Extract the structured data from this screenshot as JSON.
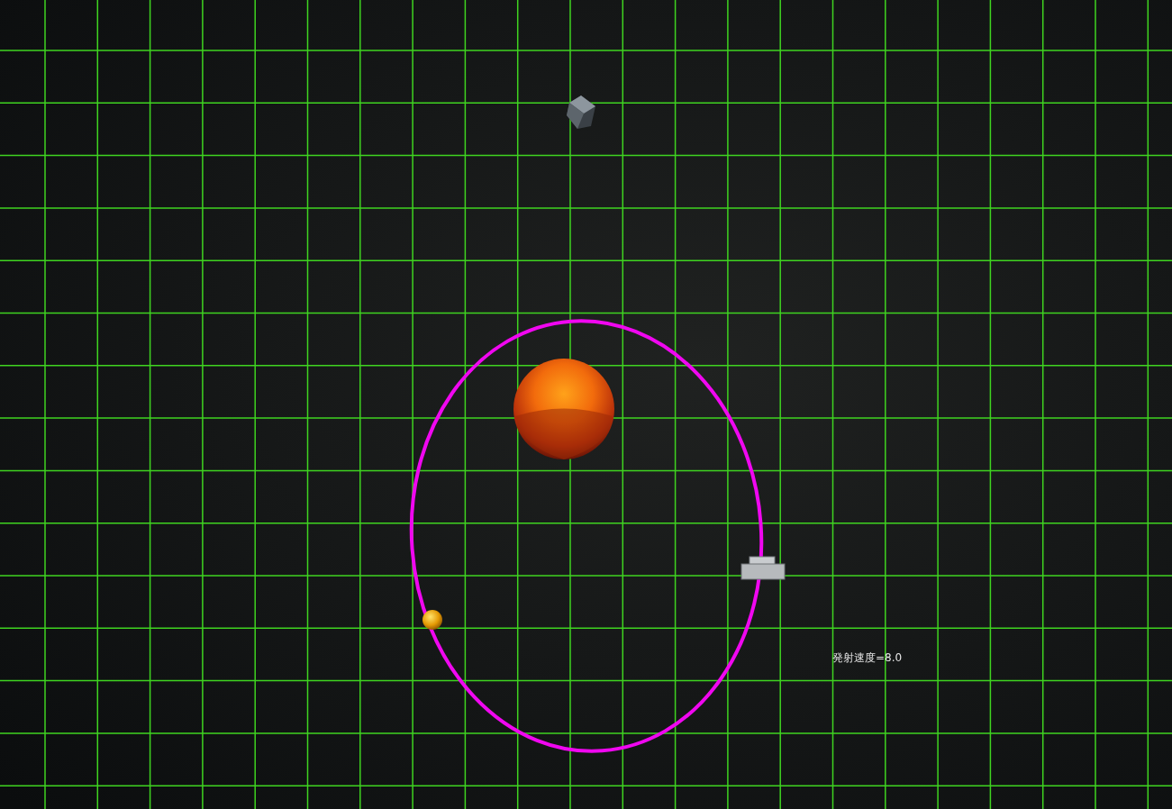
{
  "speed_label": "発射速度=8.0"
}
